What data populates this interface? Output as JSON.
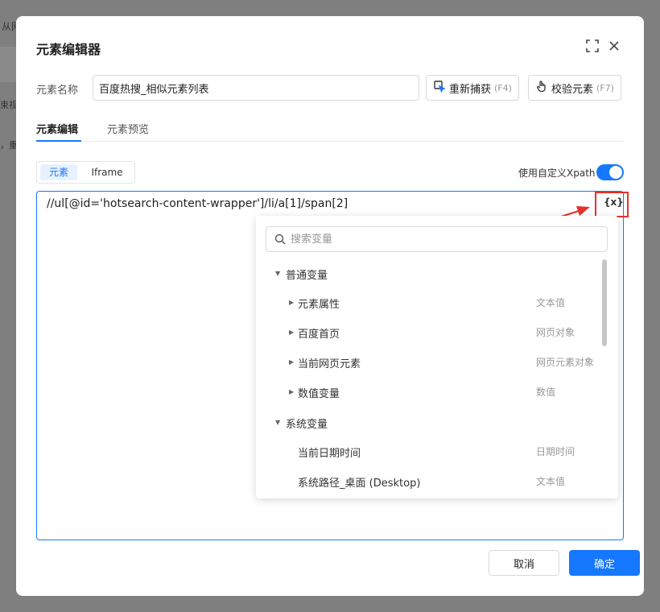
{
  "background": {
    "snippets": [
      "从网",
      "束视",
      "，重"
    ]
  },
  "dialog": {
    "title": "元素编辑器",
    "name_label": "元素名称",
    "name_value": "百度热搜_相似元素列表",
    "recapture_button": {
      "label": "重新捕获",
      "key": "(F4)"
    },
    "validate_button": {
      "label": "校验元素",
      "key": "(F7)"
    },
    "tabs": [
      {
        "label": "元素编辑",
        "active": true
      },
      {
        "label": "元素预览",
        "active": false
      }
    ],
    "mode_segment": [
      {
        "label": "元素",
        "active": true
      },
      {
        "label": "Iframe",
        "active": false
      }
    ],
    "custom_xpath_label": "使用自定义Xpath",
    "custom_xpath_enabled": true,
    "xpath_value": "//ul[@id='hotsearch-content-wrapper']/li/a[1]/span[2]",
    "variable_button_label": "{x}",
    "footer": {
      "cancel_label": "取消",
      "ok_label": "确定"
    }
  },
  "variable_dropdown": {
    "search_placeholder": "搜索变量",
    "groups": [
      {
        "label": "普通变量",
        "items": [
          {
            "label": "元素属性",
            "type": "文本值"
          },
          {
            "label": "百度首页",
            "type": "网页对象"
          },
          {
            "label": "当前网页元素",
            "type": "网页元素对象"
          },
          {
            "label": "数值变量",
            "type": "数值"
          }
        ]
      },
      {
        "label": "系统变量",
        "items": [
          {
            "label": "当前日期时间",
            "type": "日期时间"
          },
          {
            "label": "系统路径_桌面 (Desktop)",
            "type": "文本值"
          }
        ]
      }
    ]
  },
  "colors": {
    "accent": "#1677ff",
    "highlight": "#e8302c",
    "overlay": "#7f7f7f"
  }
}
